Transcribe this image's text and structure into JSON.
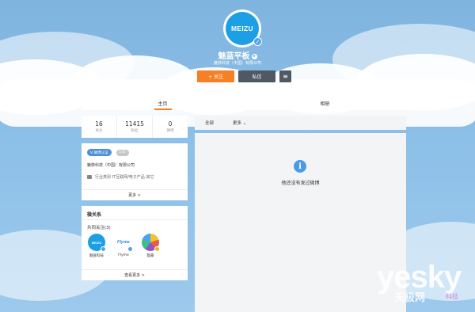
{
  "profile": {
    "avatar_text": "MEIZU",
    "name": "魅蓝平板",
    "company": "魅族科技（中国）有限公司"
  },
  "actions": {
    "follow_label": "+ 关注",
    "message_label": "私信",
    "menu_icon": "≡"
  },
  "tabs": [
    {
      "label": "主页",
      "active": true
    },
    {
      "label": "相册",
      "active": false
    }
  ],
  "stats": [
    {
      "value": "16",
      "label": "关注"
    },
    {
      "value": "11415",
      "label": "粉丝"
    },
    {
      "value": "0",
      "label": "微博"
    }
  ],
  "verification": {
    "badge": "V 微博认证",
    "level": "Lv5",
    "company": "魅族科技（中国）有限公司",
    "industry": "行业类别  IT互联网/电子产品-其它",
    "more": "更多 >"
  },
  "relations": {
    "title": "微关系",
    "subtitle": "共同关注(3)",
    "users": [
      {
        "name": "魅族科技",
        "avatar_text": "MEIZU",
        "icon": "meizu-logo-icon"
      },
      {
        "name": "Flyme",
        "avatar_text": "Flyme",
        "icon": "flyme-logo-icon"
      },
      {
        "name": "殷豪",
        "avatar_text": "",
        "icon": "user-photo-icon"
      }
    ],
    "more": "查看更多 >"
  },
  "feed": {
    "filter_all": "全部",
    "filter_more": "更多 ⌄",
    "empty_message": "他还没有发过微博",
    "info_icon": "i"
  },
  "watermark": {
    "brand": "yesky",
    "cn": "天极网",
    "small": "科技"
  }
}
